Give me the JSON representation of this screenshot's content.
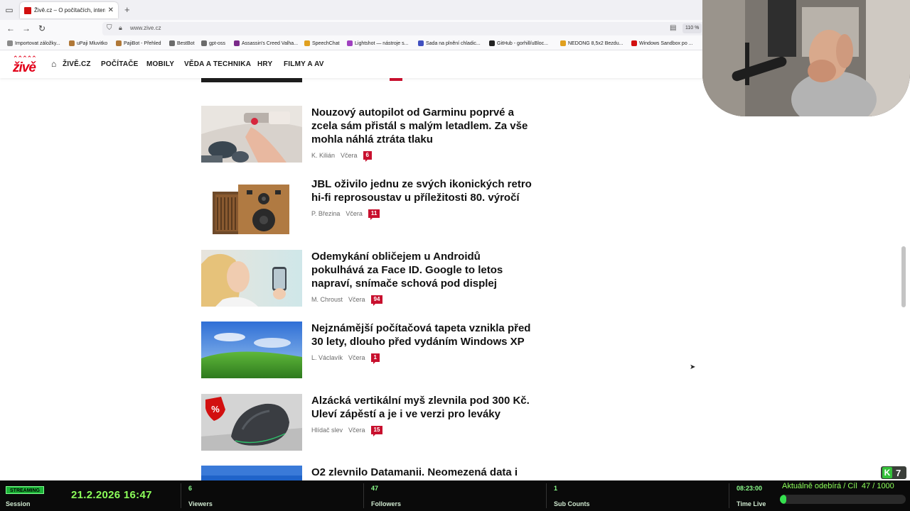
{
  "browser": {
    "tab_title": "Živě.cz – O počítačích, internetu",
    "url": "www.zive.cz",
    "zoom": "110 %",
    "bookmarks": [
      {
        "label": "Importovat záložky...",
        "color": "#8a8a8a"
      },
      {
        "label": "uPaji Mluvitko",
        "color": "#b07838"
      },
      {
        "label": "PajiBot - Přehled",
        "color": "#b07838"
      },
      {
        "label": "BestBot",
        "color": "#6b6b6b"
      },
      {
        "label": "gpt-oss",
        "color": "#6b6b6b"
      },
      {
        "label": "Assassin's Creed Valha...",
        "color": "#7a2a8a"
      },
      {
        "label": "SpeechChat",
        "color": "#e0a020"
      },
      {
        "label": "Lightshot — nástroje s...",
        "color": "#a040c0"
      },
      {
        "label": "Sada na plnění chladic...",
        "color": "#4050c0"
      },
      {
        "label": "GitHub - gorhill/uBloc...",
        "color": "#222222"
      },
      {
        "label": "NEDONG 8,5x2 Bezdu...",
        "color": "#e0a020"
      },
      {
        "label": "Windows Sandbox po ...",
        "color": "#d21010"
      }
    ]
  },
  "site": {
    "logo": "živě",
    "nav": [
      "ŽIVĚ.CZ",
      "POČÍTAČE",
      "MOBILY",
      "VĚDA A TECHNIKA",
      "HRY",
      "FILMY A AV"
    ],
    "accent": "#e2001a"
  },
  "articles": [
    {
      "title": "Nouzový autopilot od Garminu poprvé a zcela sám přistál s malým letadlem. Za vše mohla náhlá ztráta tlaku",
      "author": "K. Kilián",
      "date": "Včera",
      "comments": "6"
    },
    {
      "title": "JBL oživilo jednu ze svých ikonických retro hi-fi reprosoustav u příležitosti 80. výročí",
      "author": "P. Březina",
      "date": "Včera",
      "comments": "11"
    },
    {
      "title": "Odemykání obličejem u Androidů pokulhává za Face ID. Google to letos napraví, snímače schová pod displej",
      "author": "M. Chroust",
      "date": "Včera",
      "comments": "94"
    },
    {
      "title": "Nejznámější počítačová tapeta vznikla před 30 lety, dlouho před vydáním Windows XP",
      "author": "L. Václavík",
      "date": "Včera",
      "comments": "1"
    },
    {
      "title": "Alzácká vertikální myš zlevnila pod 300 Kč. Uleví zápěstí a je i ve verzi pro leváky",
      "author": "Hlídač slev",
      "date": "Včera",
      "comments": "15"
    },
    {
      "title": "O2 zlevnilo Datamanii. Neomezená data i",
      "author": "",
      "date": "",
      "comments": ""
    }
  ],
  "stream": {
    "status": "STREAMING",
    "session_label": "Session",
    "datetime": "21.2.2026 16:47",
    "viewers": "6",
    "viewers_label": "Viewers",
    "followers": "47",
    "followers_label": "Followers",
    "subs": "1",
    "subs_label": "Sub Counts",
    "time_live": "08:23:00",
    "time_live_label": "Time Live",
    "goal_label": "Aktuálně odebírá / Cíl",
    "goal_current": 47,
    "goal_target": 1000,
    "goal_text": "47 / 1000",
    "badge_letter": "K",
    "badge_number": "7"
  }
}
